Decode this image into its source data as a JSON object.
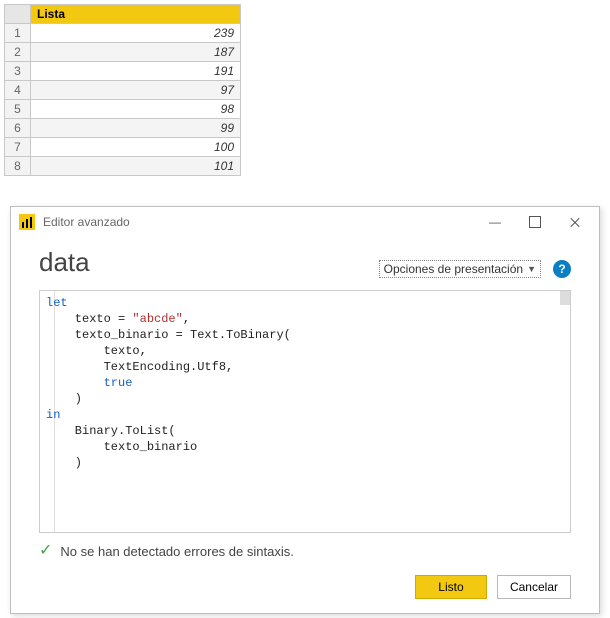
{
  "table": {
    "header": "Lista",
    "rows": [
      {
        "idx": "1",
        "val": "239"
      },
      {
        "idx": "2",
        "val": "187"
      },
      {
        "idx": "3",
        "val": "191"
      },
      {
        "idx": "4",
        "val": "97"
      },
      {
        "idx": "5",
        "val": "98"
      },
      {
        "idx": "6",
        "val": "99"
      },
      {
        "idx": "7",
        "val": "100"
      },
      {
        "idx": "8",
        "val": "101"
      }
    ]
  },
  "dialog": {
    "window_title": "Editor avanzado",
    "title": "data",
    "options_label": "Opciones de presentación",
    "help_glyph": "?",
    "status": "No se han detectado errores de sintaxis.",
    "buttons": {
      "done": "Listo",
      "cancel": "Cancelar"
    },
    "code": {
      "kw_let": "let",
      "line2a": "    texto = ",
      "str1": "\"abcde\"",
      "line2b": ",",
      "line3": "    texto_binario = Text.ToBinary(",
      "line4": "        texto,",
      "line5": "        TextEncoding.Utf8,",
      "line6_indent": "        ",
      "kw_true": "true",
      "line7": "    )",
      "kw_in": "in",
      "line9": "    Binary.ToList(",
      "line10": "        texto_binario",
      "line11": "    )"
    }
  }
}
